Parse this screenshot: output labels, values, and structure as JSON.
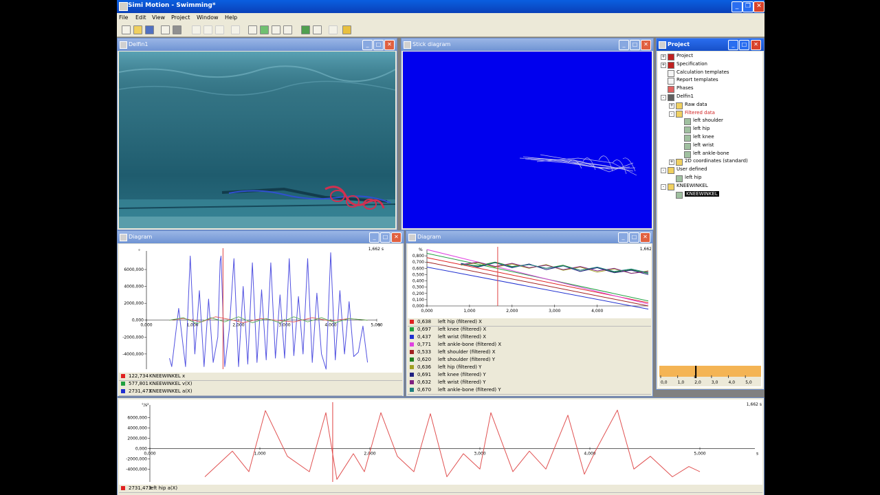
{
  "app": {
    "title": "Simi Motion - Swimming*"
  },
  "menu": [
    "File",
    "Edit",
    "View",
    "Project",
    "Window",
    "Help"
  ],
  "windows": {
    "video": {
      "title": "Delfin1"
    },
    "stick": {
      "title": "Stick diagram"
    },
    "project": {
      "title": "Project",
      "tree": [
        {
          "label": "Project",
          "level": 0,
          "icon": "gear-red",
          "expander": "+"
        },
        {
          "label": "Specification",
          "level": 0,
          "icon": "gear-red",
          "expander": "+"
        },
        {
          "label": "Calculation templates",
          "level": 0,
          "icon": "doc"
        },
        {
          "label": "Report templates",
          "level": 0,
          "icon": "doc"
        },
        {
          "label": "Phases",
          "level": 0,
          "icon": "red-doc"
        },
        {
          "label": "Delfin1",
          "level": 0,
          "icon": "camera",
          "expander": "-"
        },
        {
          "label": "Raw data",
          "level": 1,
          "icon": "folder",
          "expander": "+"
        },
        {
          "label": "Filtered data",
          "level": 1,
          "icon": "folder",
          "expander": "-",
          "highlight": true
        },
        {
          "label": "left shoulder",
          "level": 2,
          "icon": "data"
        },
        {
          "label": "left hip",
          "level": 2,
          "icon": "data"
        },
        {
          "label": "left knee",
          "level": 2,
          "icon": "data"
        },
        {
          "label": "left wrist",
          "level": 2,
          "icon": "data"
        },
        {
          "label": "left ankle-bone",
          "level": 2,
          "icon": "data"
        },
        {
          "label": "2D coordinates (standard)",
          "level": 1,
          "icon": "folder",
          "expander": "+"
        },
        {
          "label": "User defined",
          "level": 0,
          "icon": "folder",
          "expander": "-"
        },
        {
          "label": "left hip",
          "level": 1,
          "icon": "data"
        },
        {
          "label": "KNEEWINKEL",
          "level": 0,
          "icon": "folder",
          "expander": "-"
        },
        {
          "label": "KNEEWINKEL",
          "level": 1,
          "icon": "data",
          "selected": true
        }
      ],
      "timeline_ticks": [
        "0,0",
        "1,0",
        "2,0",
        "3,0",
        "4,0",
        "5,0"
      ],
      "timeline_position": 0.332
    },
    "diagram1": {
      "title": "Diagram",
      "time": "1,662 s",
      "legend": [
        {
          "color": "#e02020",
          "value": "122,734",
          "name": "KNEEWINKEL x"
        },
        {
          "color": "#20a040",
          "value": "577,801",
          "name": "KNEEWINKEL v(X)"
        },
        {
          "color": "#2030d0",
          "value": "2731,473",
          "name": "KNEEWINKEL a(X)"
        }
      ]
    },
    "diagram2": {
      "title": "Diagram",
      "time": "1,662 s",
      "legend": [
        {
          "color": "#e02020",
          "value": "0,638",
          "name": "left hip (filtered) X"
        },
        {
          "color": "#20a040",
          "value": "0,697",
          "name": "left knee (filtered) X"
        },
        {
          "color": "#2030d0",
          "value": "0,437",
          "name": "left wrist (filtered) X"
        },
        {
          "color": "#e040e0",
          "value": "0,771",
          "name": "left ankle-bone (filtered) X"
        },
        {
          "color": "#a02020",
          "value": "0,533",
          "name": "left shoulder (filtered) X"
        },
        {
          "color": "#208020",
          "value": "0,620",
          "name": "left shoulder (filtered) Y"
        },
        {
          "color": "#a0a020",
          "value": "0,636",
          "name": "left hip (filtered) Y"
        },
        {
          "color": "#202080",
          "value": "0,691",
          "name": "left knee (filtered) Y"
        },
        {
          "color": "#802080",
          "value": "0,632",
          "name": "left wrist (filtered) Y"
        },
        {
          "color": "#208080",
          "value": "0,670",
          "name": "left ankle-bone (filtered) Y"
        }
      ]
    },
    "diagram3": {
      "time": "1,662 s",
      "legend": [
        {
          "color": "#e02020",
          "value": "2731,473",
          "name": "left hip a(X)"
        }
      ]
    }
  },
  "chart_data": [
    {
      "type": "line",
      "ylabel": "°",
      "ytick_labels": [
        "6000,000",
        "4000,000",
        "2000,000",
        "0,000",
        "-2000,000",
        "-4000,000"
      ],
      "xtick_labels": [
        "0,000",
        "1,000",
        "2,000",
        "3,000",
        "4,000",
        "5,000"
      ],
      "xunit": "s",
      "ylim": [
        -5800,
        8200
      ],
      "xlim": [
        0,
        5
      ],
      "series": [
        {
          "color": "#5050e0",
          "x": [
            0.5,
            0.55,
            0.7,
            0.85,
            0.95,
            1.05,
            1.15,
            1.25,
            1.35,
            1.45,
            1.55,
            1.6,
            1.62,
            1.7,
            1.8,
            1.9,
            2.0,
            2.1,
            2.2,
            2.3,
            2.4,
            2.5,
            2.6,
            2.7,
            2.8,
            2.9,
            3.0,
            3.1,
            3.2,
            3.3,
            3.4,
            3.5,
            3.6,
            3.7,
            3.8,
            3.9,
            4.0,
            4.1,
            4.2,
            4.3,
            4.4,
            4.5,
            4.6,
            4.7,
            4.8
          ],
          "y": [
            -4500,
            -5500,
            1400,
            -5500,
            7600,
            -4000,
            3500,
            -5500,
            2500,
            -5000,
            -2000,
            7000,
            7600,
            -5500,
            -1000,
            7300,
            -5500,
            4000,
            -5200,
            6800,
            -5000,
            3600,
            -4700,
            6800,
            -4500,
            3000,
            -4500,
            7300,
            -4200,
            2800,
            -4000,
            7300,
            -5000,
            3200,
            -4000,
            -5800,
            8000,
            -4700,
            3500,
            -4000,
            2200,
            -4300,
            -3800,
            -700,
            -5000
          ]
        },
        {
          "color": "#e06060",
          "x": [
            0.5,
            0.8,
            1.2,
            1.5,
            1.8,
            2.1,
            2.5,
            2.8,
            3.2,
            3.6,
            4.0,
            4.4,
            4.8
          ],
          "y": [
            0,
            200,
            -200,
            400,
            100,
            -300,
            200,
            0,
            -200,
            300,
            -100,
            200,
            0
          ]
        },
        {
          "color": "#60b060",
          "x": [
            0.5,
            0.8,
            1.1,
            1.4,
            1.7,
            2.0,
            2.3,
            2.6,
            2.9,
            3.2,
            3.5,
            3.8,
            4.1,
            4.4,
            4.8
          ],
          "y": [
            0,
            300,
            -400,
            300,
            -200,
            400,
            -300,
            200,
            -300,
            400,
            -200,
            300,
            -300,
            200,
            0
          ]
        }
      ]
    },
    {
      "type": "line",
      "ylabel": "%",
      "ytick_labels": [
        "0,800",
        "0,700",
        "0,600",
        "0,500",
        "0,400",
        "0,300",
        "0,200",
        "0,100",
        "0,000"
      ],
      "xtick_labels": [
        "0,000",
        "1,000",
        "2,000",
        "3,000",
        "4,000"
      ],
      "ylim": [
        0,
        0.9
      ],
      "xlim": [
        0,
        5.2
      ],
      "series": [
        {
          "color": "#e02020",
          "x": [
            0,
            5.2
          ],
          "y": [
            0.77,
            0.05
          ]
        },
        {
          "color": "#20a040",
          "x": [
            0,
            5.2
          ],
          "y": [
            0.84,
            0.08
          ]
        },
        {
          "color": "#2030d0",
          "x": [
            0,
            5.2
          ],
          "y": [
            0.62,
            -0.05
          ]
        },
        {
          "color": "#e040e0",
          "x": [
            0,
            5.2
          ],
          "y": [
            0.9,
            0.03
          ]
        },
        {
          "color": "#a02020",
          "x": [
            0,
            5.2
          ],
          "y": [
            0.7,
            0.0
          ]
        },
        {
          "color": "#208020",
          "x": [
            0.8,
            1.2,
            1.6,
            2.0,
            2.4,
            2.8,
            3.2,
            3.6,
            4.0,
            4.4,
            4.8,
            5.2
          ],
          "y": [
            0.67,
            0.64,
            0.7,
            0.63,
            0.66,
            0.6,
            0.65,
            0.57,
            0.61,
            0.54,
            0.58,
            0.52
          ]
        },
        {
          "color": "#a0a020",
          "x": [
            0.8,
            1.2,
            1.6,
            2.0,
            2.4,
            2.8,
            3.2,
            3.6,
            4.0,
            4.4,
            4.8,
            5.2
          ],
          "y": [
            0.65,
            0.69,
            0.62,
            0.67,
            0.6,
            0.66,
            0.57,
            0.62,
            0.54,
            0.59,
            0.52,
            0.56
          ]
        },
        {
          "color": "#202080",
          "x": [
            0.8,
            1.2,
            1.6,
            2.0,
            2.4,
            2.8,
            3.2,
            3.6,
            4.0,
            4.4,
            4.8,
            5.2
          ],
          "y": [
            0.68,
            0.62,
            0.69,
            0.61,
            0.67,
            0.58,
            0.64,
            0.55,
            0.61,
            0.53,
            0.57,
            0.5
          ]
        },
        {
          "color": "#802080",
          "x": [
            0.8,
            1.2,
            1.6,
            2.0,
            2.4,
            2.8,
            3.2,
            3.6,
            4.0,
            4.4,
            4.8,
            5.2
          ],
          "y": [
            0.66,
            0.7,
            0.63,
            0.68,
            0.61,
            0.65,
            0.58,
            0.63,
            0.56,
            0.6,
            0.52,
            0.55
          ]
        },
        {
          "color": "#208080",
          "x": [
            0.8,
            1.2,
            1.6,
            2.0,
            2.4,
            2.8,
            3.2,
            3.6,
            4.0,
            4.4,
            4.8,
            5.2
          ],
          "y": [
            0.67,
            0.63,
            0.69,
            0.62,
            0.66,
            0.6,
            0.64,
            0.57,
            0.62,
            0.55,
            0.59,
            0.53
          ]
        }
      ]
    },
    {
      "type": "line",
      "ylabel": "°/s²",
      "ytick_labels": [
        "6000,000",
        "4000,000",
        "2000,000",
        "0,000",
        "-2000,000",
        "-4000,000"
      ],
      "xtick_labels": [
        "0,000",
        "1,000",
        "2,000",
        "3,000",
        "4,000",
        "5,000"
      ],
      "xunit": "s",
      "ylim": [
        -6500,
        8500
      ],
      "xlim": [
        0,
        5.5
      ],
      "series": [
        {
          "color": "#e05050",
          "x": [
            0.5,
            0.75,
            0.9,
            1.05,
            1.25,
            1.45,
            1.6,
            1.7,
            1.85,
            1.95,
            2.1,
            2.25,
            2.4,
            2.55,
            2.7,
            2.85,
            3.0,
            3.1,
            3.3,
            3.45,
            3.6,
            3.8,
            3.95,
            4.05,
            4.25,
            4.4,
            4.55,
            4.75,
            4.9,
            5.0
          ],
          "y": [
            -5500,
            -500,
            -4500,
            7400,
            -1500,
            -4500,
            7000,
            -6000,
            -1000,
            -4500,
            7000,
            -1500,
            -4500,
            6800,
            -5500,
            -1000,
            -4000,
            7000,
            -4500,
            -500,
            -4000,
            6500,
            -5000,
            -500,
            7500,
            -4000,
            -1500,
            -5500,
            -3500,
            -4500
          ]
        }
      ]
    }
  ]
}
